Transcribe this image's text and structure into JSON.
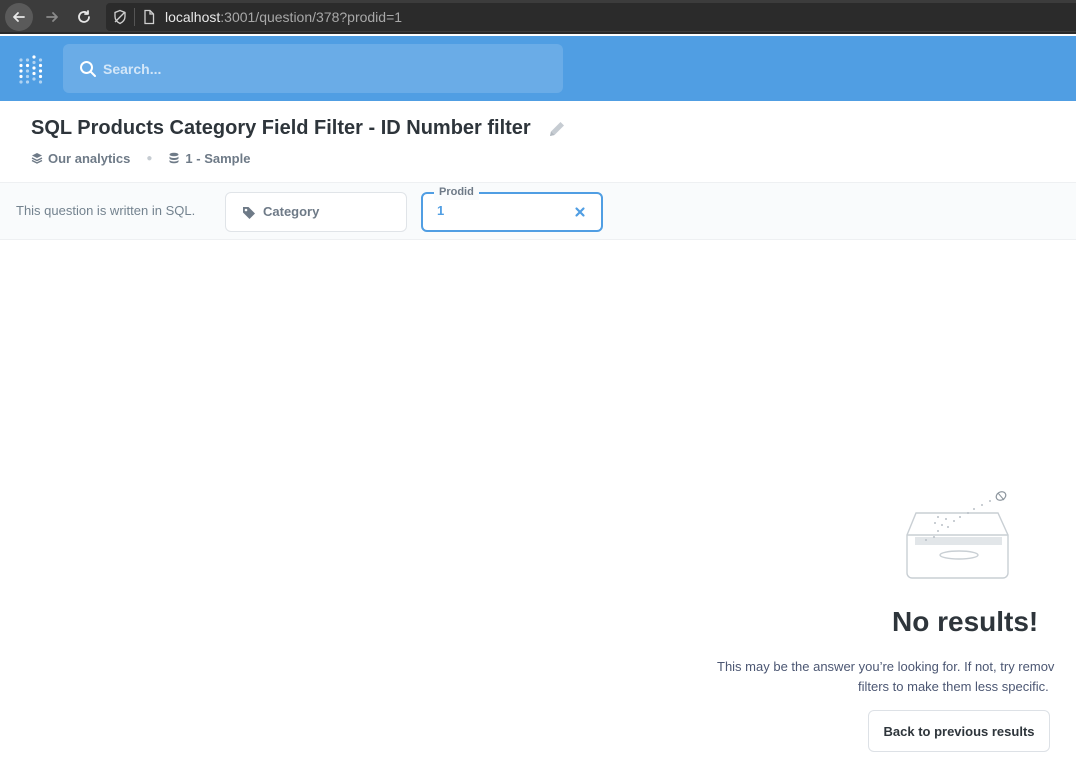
{
  "browser": {
    "url_host": "localhost",
    "url_rest": ":3001/question/378?prodid=1"
  },
  "header": {
    "search_placeholder": "Search..."
  },
  "question": {
    "title": "SQL Products Category Field Filter - ID Number filter",
    "breadcrumb": [
      {
        "label": "Our analytics",
        "icon": "collection-icon"
      },
      {
        "label": "1 - Sample",
        "icon": "database-icon"
      }
    ]
  },
  "filters": {
    "sql_note": "This question is written in SQL.",
    "category": {
      "label": "Category",
      "icon": "tag-icon"
    },
    "prodid": {
      "legend": "Prodid",
      "value": "1"
    }
  },
  "empty_state": {
    "title": "No results!",
    "message_line1": "This may be the answer you’re looking for. If not, try remov",
    "message_line2": "filters to make them less specific.",
    "back_button": "Back to previous results"
  },
  "colors": {
    "brand": "#509ee3",
    "text_dark": "#2e353b",
    "text_medium": "#6e7a87"
  }
}
